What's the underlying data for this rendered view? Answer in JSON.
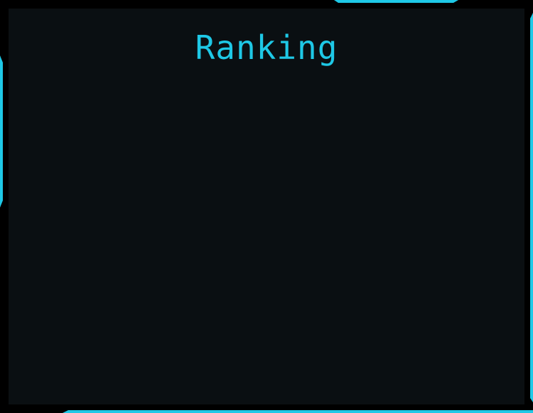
{
  "ranking_panel": {
    "title": "Ranking",
    "entries": []
  },
  "colors": {
    "accent": "#1ec8e6",
    "frame": "#050708",
    "panel_bg": "#0a0f12"
  }
}
